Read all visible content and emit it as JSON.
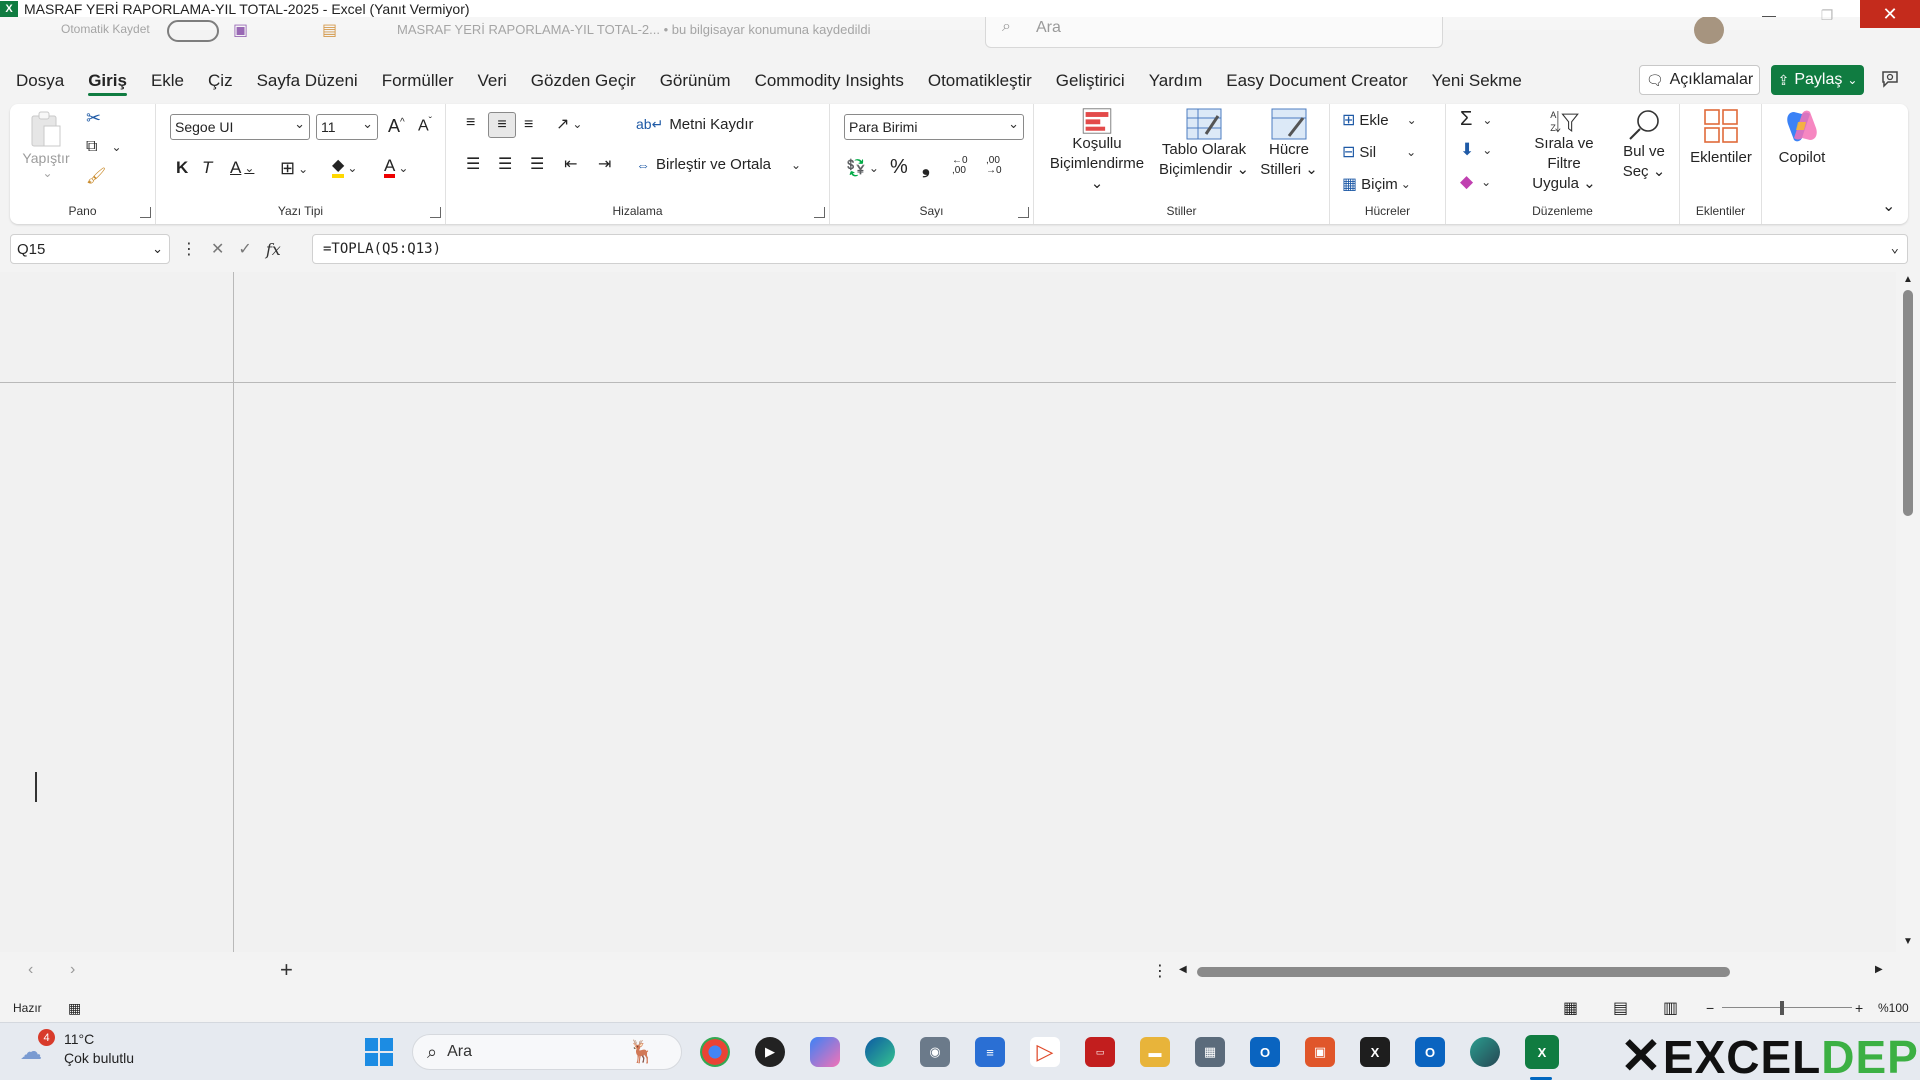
{
  "titlebar": {
    "window_title": "MASRAF YERİ RAPORLAMA-YIL TOTAL-2025 - Excel (Yanıt Vermiyor)",
    "autosave_label": "Otomatik Kaydet",
    "file_label": "MASRAF YERİ RAPORLAMA-YIL TOTAL-2...  •  bu bilgisayar konumuna kaydedildi",
    "search_placeholder": "Ara",
    "close_glyph": "✕"
  },
  "tabs": [
    {
      "label": "Dosya"
    },
    {
      "label": "Giriş",
      "active": true
    },
    {
      "label": "Ekle"
    },
    {
      "label": "Çiz"
    },
    {
      "label": "Sayfa Düzeni"
    },
    {
      "label": "Formüller"
    },
    {
      "label": "Veri"
    },
    {
      "label": "Gözden Geçir"
    },
    {
      "label": "Görünüm"
    },
    {
      "label": "Commodity Insights"
    },
    {
      "label": "Otomatikleştir"
    },
    {
      "label": "Geliştirici"
    },
    {
      "label": "Yardım"
    },
    {
      "label": "Easy Document Creator"
    },
    {
      "label": "Yeni Sekme"
    }
  ],
  "header_buttons": {
    "comments": "Açıklamalar",
    "share": "Paylaş"
  },
  "ribbon": {
    "clipboard": {
      "label": "Pano",
      "paste": "Yapıştır"
    },
    "font": {
      "label": "Yazı Tipi",
      "font_name": "Segoe UI",
      "font_size": "11",
      "bold": "K",
      "italic": "T",
      "underline": "A",
      "grow": "A^",
      "shrink": "Aˇ"
    },
    "alignment": {
      "label": "Hizalama",
      "wrap": "Metni Kaydır",
      "merge": "Birleştir ve Ortala"
    },
    "number": {
      "label": "Sayı",
      "format": "Para Birimi",
      "percent": "%",
      "comma": "❟",
      "inc_dec": "←0\n,00",
      "dec_dec": ",00\n→0"
    },
    "styles": {
      "label": "Stiller",
      "conditional_1": "Koşullu",
      "conditional_2": "Biçimlendirme",
      "table_1": "Tablo Olarak",
      "table_2": "Biçimlendir",
      "cell_1": "Hücre",
      "cell_2": "Stilleri"
    },
    "cells": {
      "label": "Hücreler",
      "insert": "Ekle",
      "delete": "Sil",
      "format": "Biçim"
    },
    "editing": {
      "label": "Düzenleme",
      "sort_1": "Sırala ve Filtre",
      "sort_2": "Uygula",
      "find_1": "Bul ve",
      "find_2": "Seç"
    },
    "addins": {
      "label": "Eklentiler",
      "button": "Eklentiler"
    },
    "copilot": {
      "label": "Copilot"
    }
  },
  "formula_bar": {
    "name_box": "Q15",
    "fx": "fx",
    "formula": "=TOPLA(Q5:Q13)"
  },
  "status": {
    "ready": "Hazır",
    "zoom": "%100"
  },
  "taskbar": {
    "weather_badge": "4",
    "temperature": "11°C",
    "weather_desc": "Çok bulutlu",
    "search_label": "Ara"
  },
  "brand": {
    "text_a": "EXCEL",
    "text_b": "DEPO"
  },
  "colors": {
    "accent": "#107c41",
    "close": "#c42b1c"
  }
}
